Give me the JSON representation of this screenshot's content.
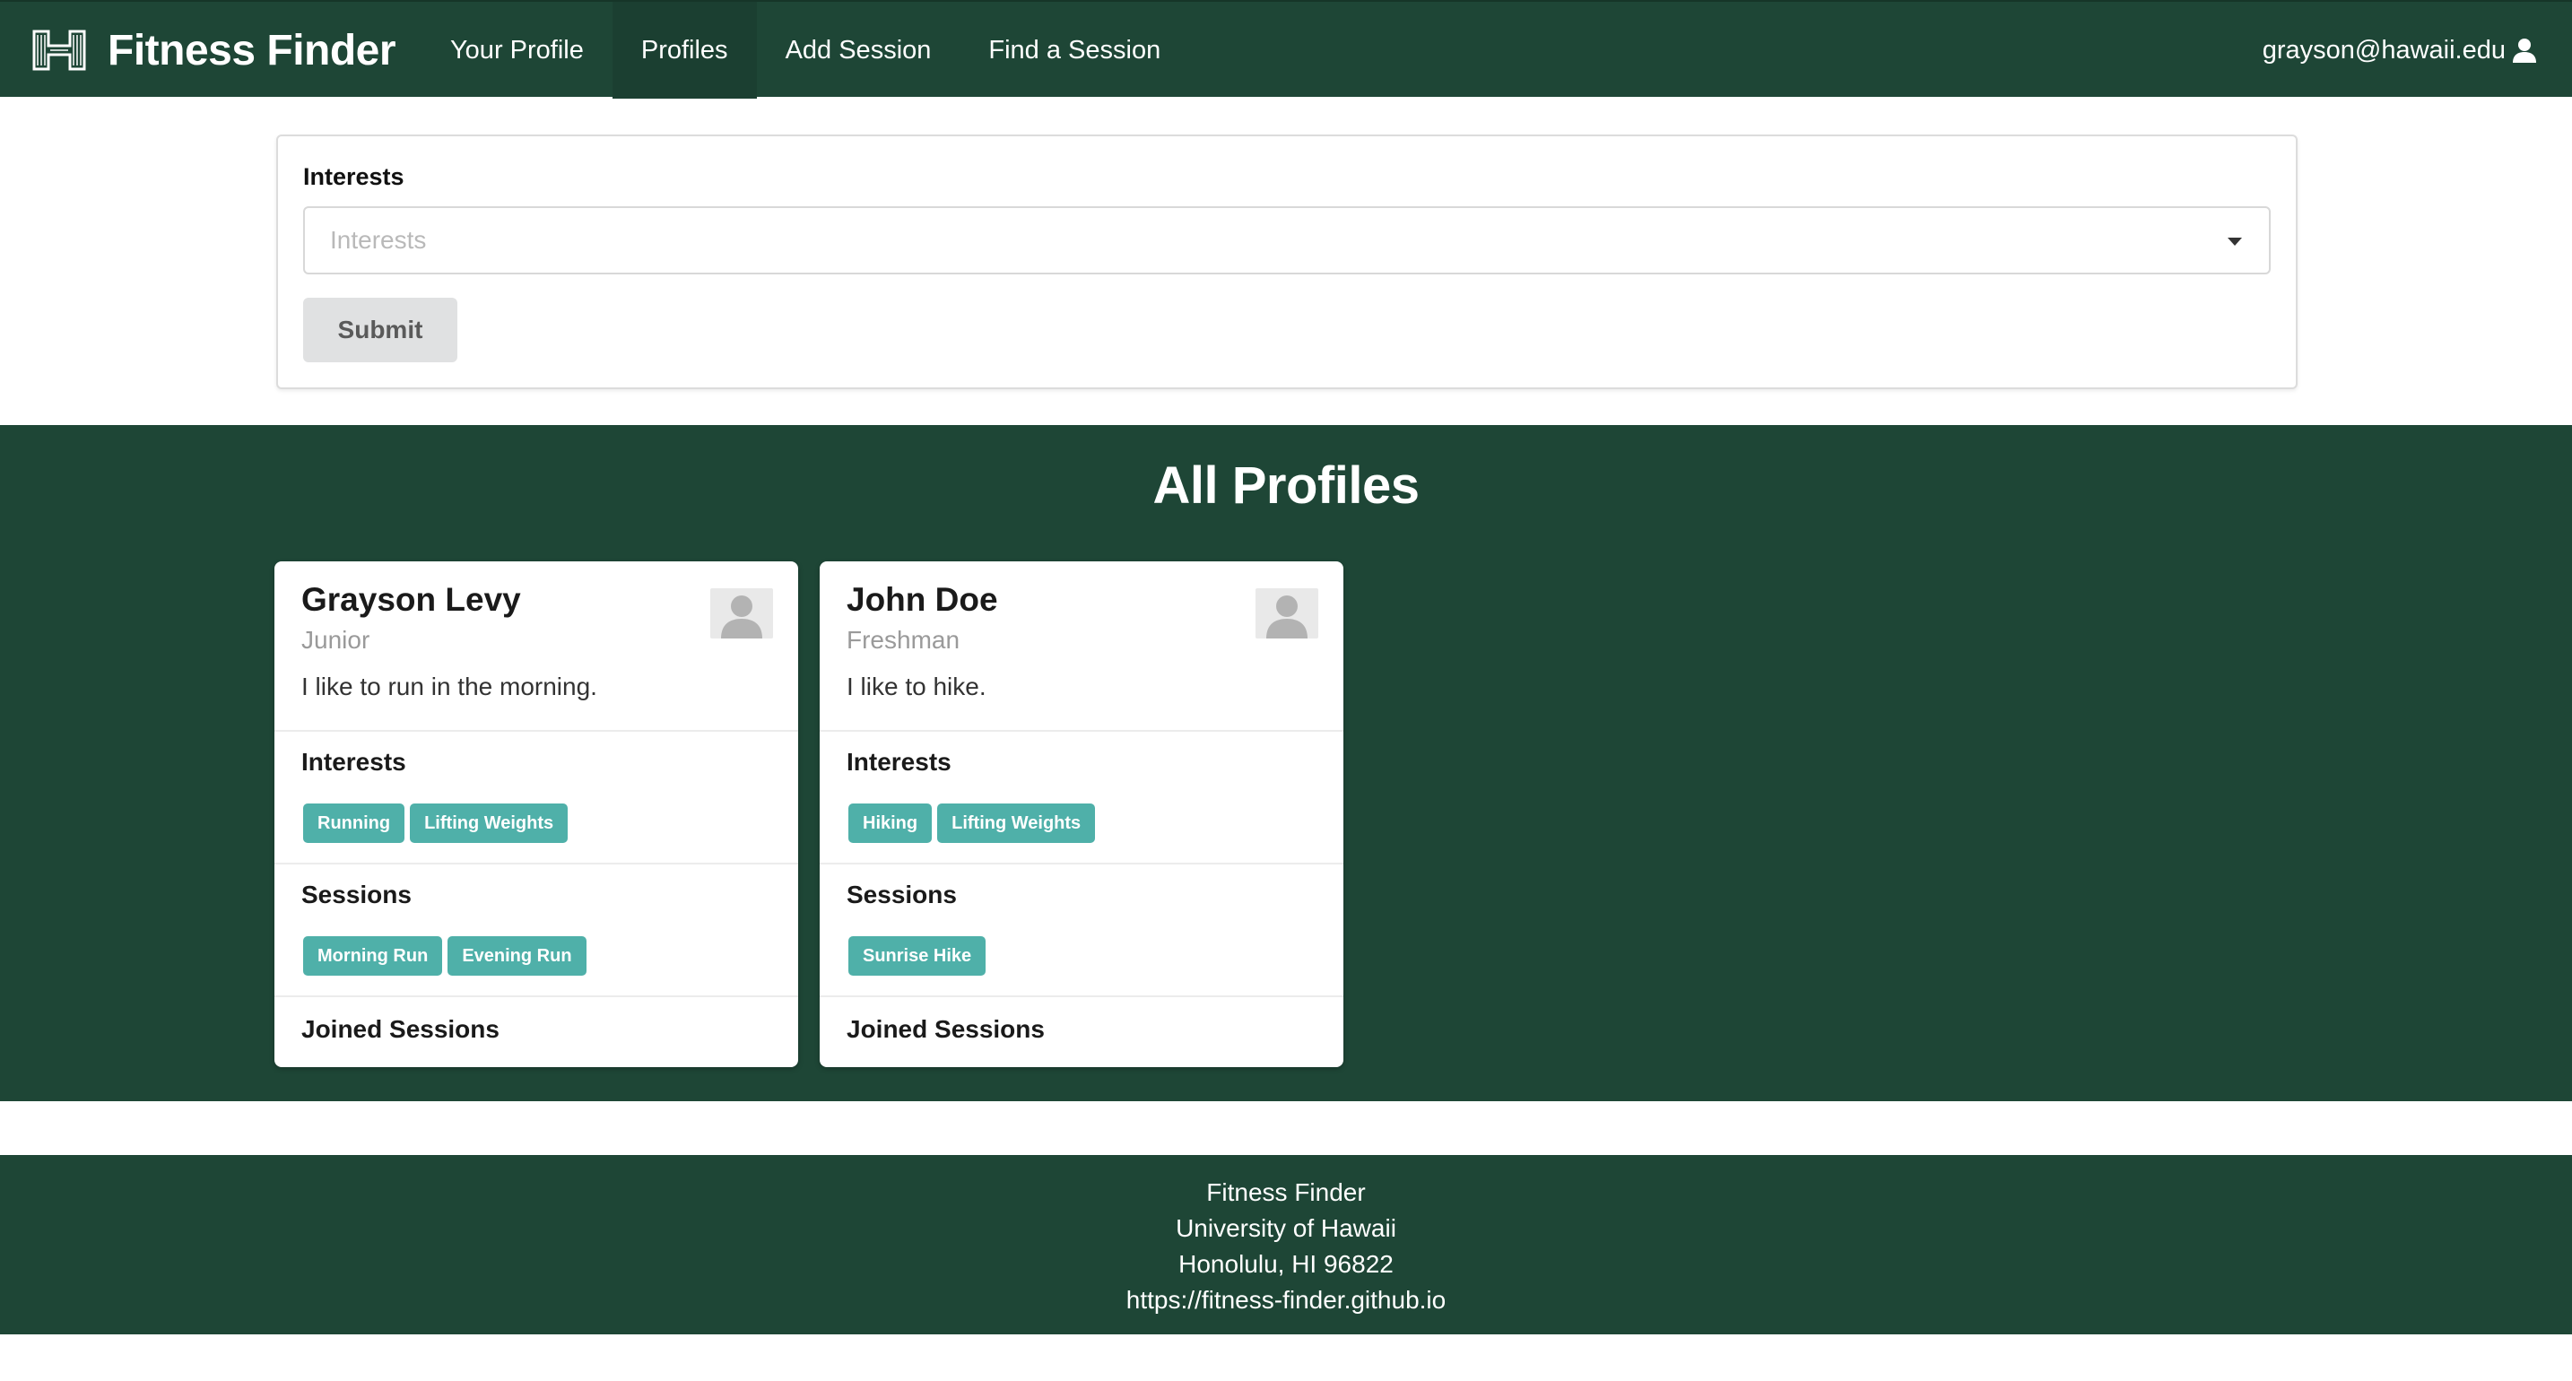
{
  "navbar": {
    "brand": "Fitness Finder",
    "logo_icon": "uh-h-logo-icon",
    "links": [
      "Your Profile",
      "Profiles",
      "Add Session",
      "Find a Session"
    ],
    "active_link": "Profiles",
    "user_email": "grayson@hawaii.edu",
    "user_icon": "user-icon"
  },
  "filter": {
    "label": "Interests",
    "placeholder": "Interests",
    "submit_label": "Submit"
  },
  "profiles_section": {
    "title": "All Profiles",
    "profiles": [
      {
        "name": "Grayson Levy",
        "year": "Junior",
        "bio": "I like to run in the morning.",
        "interests_title": "Interests",
        "interests": [
          "Running",
          "Lifting Weights"
        ],
        "sessions_title": "Sessions",
        "sessions": [
          "Morning Run",
          "Evening Run"
        ],
        "joined_title": "Joined Sessions"
      },
      {
        "name": "John Doe",
        "year": "Freshman",
        "bio": "I like to hike.",
        "interests_title": "Interests",
        "interests": [
          "Hiking",
          "Lifting Weights"
        ],
        "sessions_title": "Sessions",
        "sessions": [
          "Sunrise Hike"
        ],
        "joined_title": "Joined Sessions"
      }
    ]
  },
  "footer": {
    "lines": [
      "Fitness Finder",
      "University of Hawaii",
      "Honolulu, HI 96822",
      "https://fitness-finder.github.io"
    ]
  },
  "colors": {
    "brand_green": "#1e4636",
    "tag_teal": "#4fb0a9",
    "button_gray": "#e0e1e2"
  }
}
